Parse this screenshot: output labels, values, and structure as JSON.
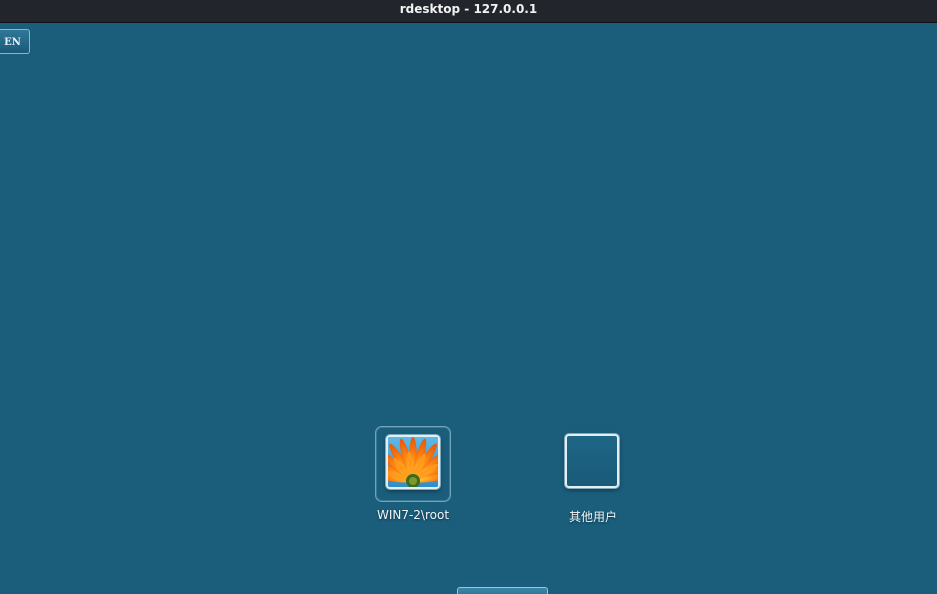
{
  "window": {
    "title": "rdesktop - 127.0.0.1"
  },
  "language_indicator": {
    "label": "EN"
  },
  "users": [
    {
      "label": "WIN7-2\\root",
      "avatar_icon": "orange-flower-icon"
    },
    {
      "label": "其他用户",
      "avatar_icon": "blank-user-tile-icon"
    }
  ],
  "colors": {
    "desktop_bg": "#1a5e7c",
    "titlebar_bg": "#22262c",
    "titlebar_text": "#f2f2f2"
  }
}
